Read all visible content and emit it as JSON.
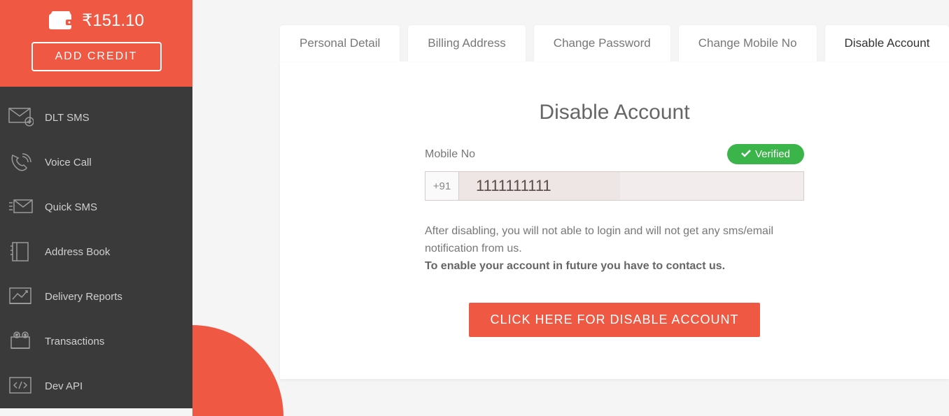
{
  "sidebar": {
    "credit_amount": "₹151.10",
    "add_credit_label": "ADD CREDIT",
    "items": [
      {
        "label": "DLT SMS"
      },
      {
        "label": "Voice Call"
      },
      {
        "label": "Quick SMS"
      },
      {
        "label": "Address Book"
      },
      {
        "label": "Delivery Reports"
      },
      {
        "label": "Transactions"
      },
      {
        "label": "Dev API"
      }
    ]
  },
  "tabs": [
    {
      "label": "Personal Detail"
    },
    {
      "label": "Billing Address"
    },
    {
      "label": "Change Password"
    },
    {
      "label": "Change Mobile No"
    },
    {
      "label": "Disable Account",
      "active": true
    }
  ],
  "panel": {
    "title": "Disable Account",
    "mobile_label": "Mobile No",
    "verified_label": "Verified",
    "phone_prefix": "+91",
    "phone_number": "1111111111",
    "disclaimer_line1": "After disabling, you will not able to login and will not get any sms/email notification from us.",
    "disclaimer_line2": "To enable your account in future you have to contact us.",
    "disable_button_label": "CLICK HERE FOR DISABLE ACCOUNT"
  }
}
